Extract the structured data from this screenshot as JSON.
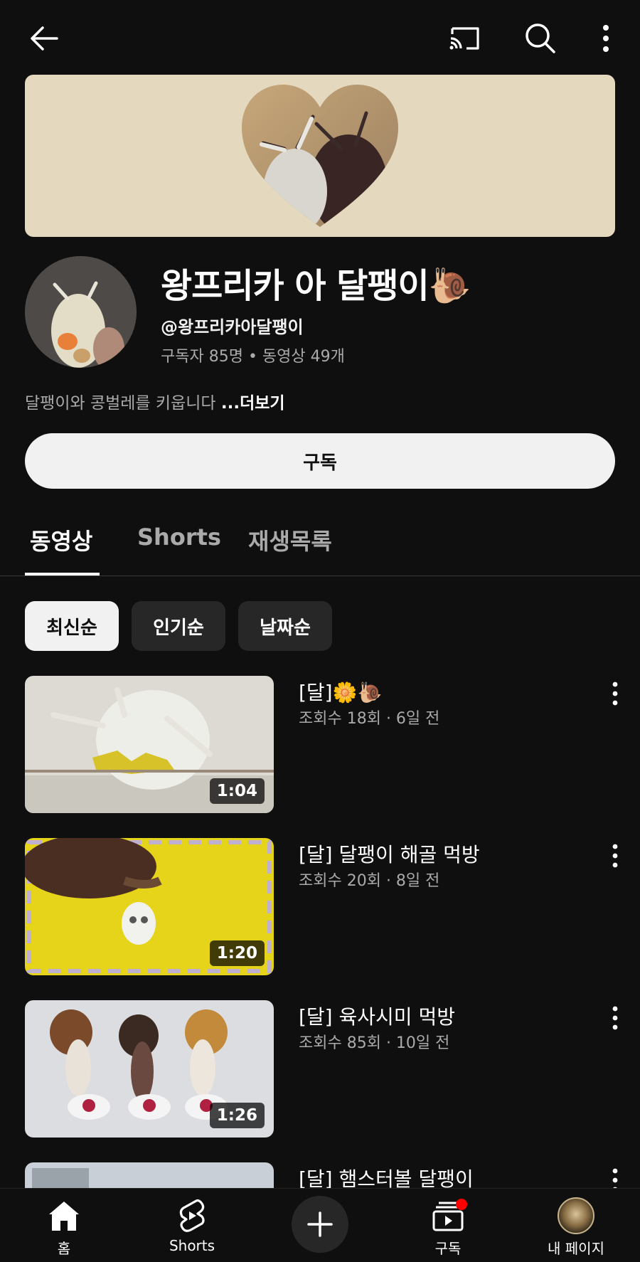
{
  "channel": {
    "title": "왕프리카 아 달팽이🐌",
    "handle": "@왕프리카아달팽이",
    "stats": "구독자 85명 • 동영상 49개",
    "description": "달팽이와 콩벌레를 키웁니다 ",
    "more_label": "...더보기",
    "subscribe_label": "구독"
  },
  "tabs": [
    {
      "label": "동영상",
      "active": true
    },
    {
      "label": "Shorts",
      "active": false
    },
    {
      "label": "재생목록",
      "active": false
    }
  ],
  "sort_chips": [
    {
      "label": "최신순",
      "selected": true
    },
    {
      "label": "인기순",
      "selected": false
    },
    {
      "label": "날짜순",
      "selected": false
    }
  ],
  "videos": [
    {
      "title": "[달]🌼🐌",
      "meta": "조회수 18회 · 6일 전",
      "duration": "1:04"
    },
    {
      "title": "[달] 달팽이 해골 먹방",
      "meta": "조회수 20회 · 8일 전",
      "duration": "1:20"
    },
    {
      "title": "[달] 육사시미 먹방",
      "meta": "조회수 85회 · 10일 전",
      "duration": "1:26"
    },
    {
      "title": "[달] 햄스터볼 달팽이",
      "meta": "",
      "duration": ""
    }
  ],
  "bottom_nav": {
    "home": "홈",
    "shorts": "Shorts",
    "subscriptions": "구독",
    "my_page": "내 페이지"
  },
  "colors": {
    "background": "#0f0f0f",
    "chip": "#272727",
    "banner": "#e4d8be",
    "notification": "#ff0000"
  }
}
